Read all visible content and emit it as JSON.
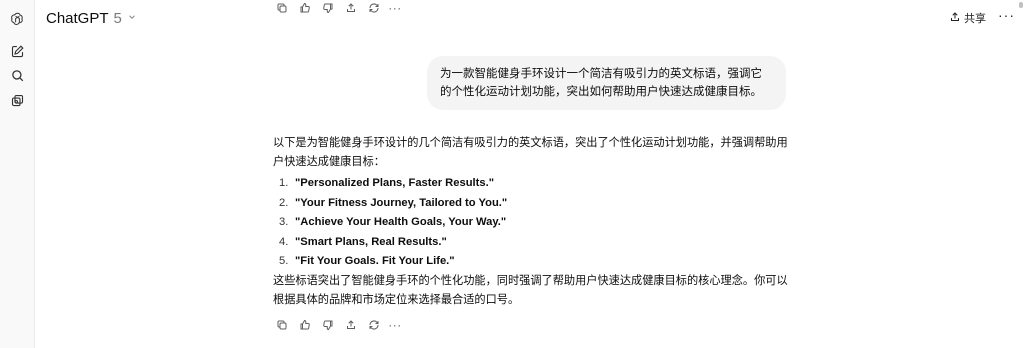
{
  "header": {
    "model_name": "ChatGPT",
    "model_version": "5",
    "share_label": "共享",
    "more_label": "···"
  },
  "sidebar": {
    "icons": [
      "openai-logo-icon",
      "new-chat-icon",
      "search-icon",
      "library-icon"
    ]
  },
  "conversation": {
    "user_message": "为一款智能健身手环设计一个简洁有吸引力的英文标语，强调它的个性化运动计划功能，突出如何帮助用户快速达成健康目标。",
    "assistant": {
      "intro": "以下是为智能健身手环设计的几个简洁有吸引力的英文标语，突出了个性化运动计划功能，并强调帮助用户快速达成健康目标：",
      "slogans": [
        {
          "num": "1.",
          "text": "\"Personalized Plans, Faster Results.\""
        },
        {
          "num": "2.",
          "text": "\"Your Fitness Journey, Tailored to You.\""
        },
        {
          "num": "3.",
          "text": "\"Achieve Your Health Goals, Your Way.\""
        },
        {
          "num": "4.",
          "text": "\"Smart Plans, Real Results.\""
        },
        {
          "num": "5.",
          "text": "\"Fit Your Goals. Fit Your Life.\""
        }
      ],
      "outro": "这些标语突出了智能健身手环的个性化功能，同时强调了帮助用户快速达成健康目标的核心理念。你可以根据具体的品牌和市场定位来选择最合适的口号。"
    },
    "action_icons": [
      "copy-icon",
      "thumbs-up-icon",
      "thumbs-down-icon",
      "share-icon",
      "regenerate-icon",
      "more-icon"
    ],
    "more_label": "···"
  }
}
